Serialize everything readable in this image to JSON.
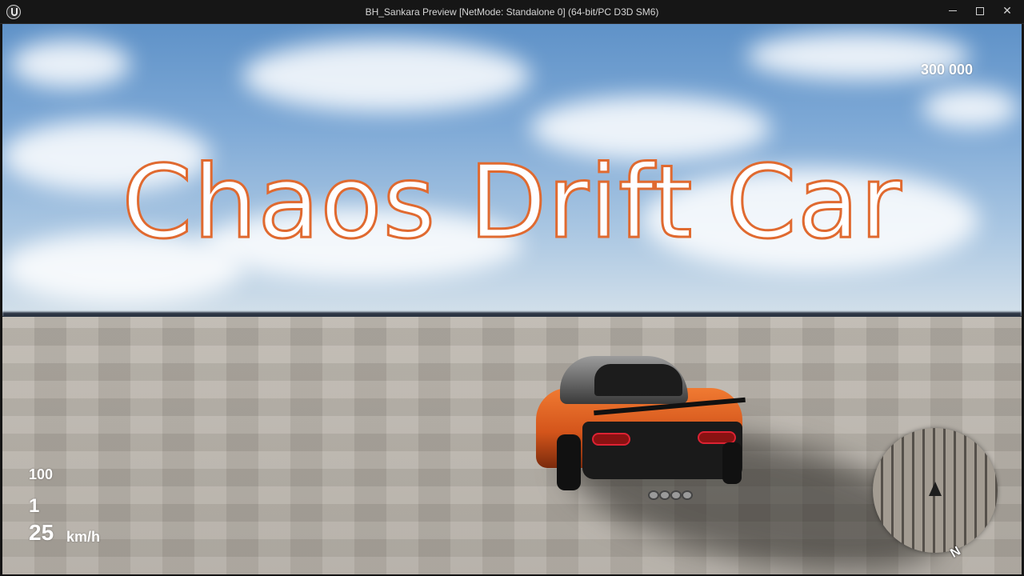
{
  "window": {
    "title": "BH_Sankara Preview [NetMode: Standalone 0]  (64-bit/PC D3D SM6)",
    "close_glyph": "✕",
    "icons": {
      "app": "unreal-engine-logo-icon",
      "minimize": "minimize-icon",
      "maximize": "maximize-icon",
      "close": "close-icon"
    }
  },
  "overlay": {
    "title": "Chaos Drift Car",
    "title_fill": "#ffffff",
    "title_stroke": "#e06a30"
  },
  "hud": {
    "score": "300 000",
    "rpm": "100",
    "gear": "1",
    "speed": "25",
    "speed_unit": "km/h"
  },
  "minimap": {
    "north_label": "N",
    "icons": {
      "player": "player-arrow-icon"
    }
  }
}
